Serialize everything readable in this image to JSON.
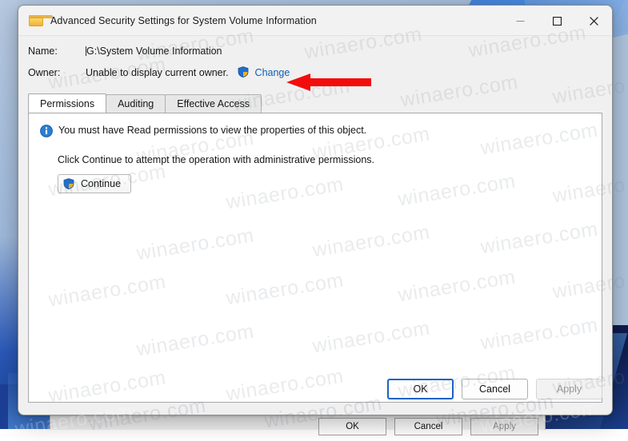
{
  "window": {
    "title": "Advanced Security Settings for System Volume Information",
    "folder_icon": "folder-icon",
    "caption": {
      "minimize": "minimize-icon",
      "maximize": "maximize-icon",
      "close": "close-icon"
    }
  },
  "header": {
    "name_label": "Name:",
    "name_value": "G:\\System Volume Information",
    "owner_label": "Owner:",
    "owner_value": "Unable to display current owner.",
    "change_link": "Change",
    "shield_icon": "uac-shield-icon"
  },
  "tabs": [
    {
      "label": "Permissions",
      "active": true
    },
    {
      "label": "Auditing",
      "active": false
    },
    {
      "label": "Effective Access",
      "active": false
    }
  ],
  "panel": {
    "info_icon": "info-icon",
    "notice": "You must have Read permissions to view the properties of this object.",
    "instruction": "Click Continue to attempt the operation with administrative permissions.",
    "continue_label": "Continue",
    "continue_shield_icon": "uac-shield-icon"
  },
  "footer": {
    "ok_label": "OK",
    "cancel_label": "Cancel",
    "apply_label": "Apply",
    "apply_disabled": true
  },
  "background_dialog": {
    "ok_label": "OK",
    "cancel_label": "Cancel",
    "apply_label": "Apply"
  },
  "annotation": {
    "arrow": "red-left-arrow",
    "arrow_color": "#f30c0c"
  },
  "watermark": {
    "text": "winaero.com"
  },
  "colors": {
    "accent": "#0a5fb4",
    "default_button_border": "#1a63c4",
    "arrow_red": "#f30c0c",
    "desktop": "#aec4de"
  }
}
